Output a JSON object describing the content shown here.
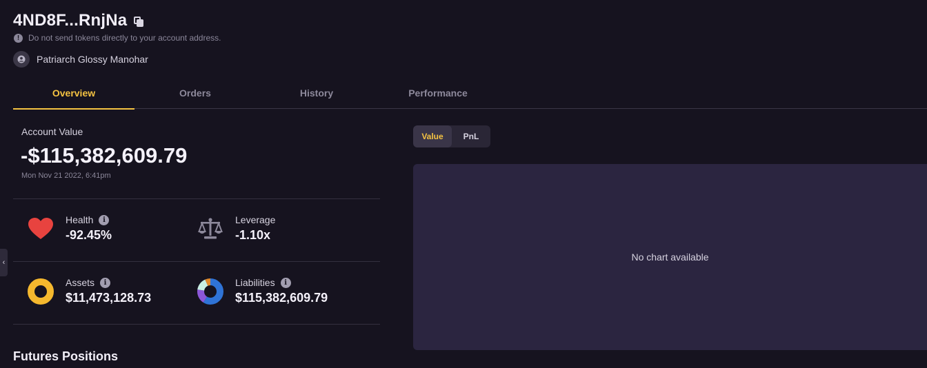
{
  "account": {
    "address_short": "4ND8F...RnjNa",
    "warning": "Do not send tokens directly to your account address.",
    "owner_name": "Patriarch Glossy Manohar"
  },
  "tabs": [
    {
      "label": "Overview",
      "active": true
    },
    {
      "label": "Orders",
      "active": false
    },
    {
      "label": "History",
      "active": false
    },
    {
      "label": "Performance",
      "active": false
    }
  ],
  "summary": {
    "account_value_label": "Account Value",
    "account_value": "-$115,382,609.79",
    "timestamp": "Mon Nov 21 2022, 6:41pm"
  },
  "stats": {
    "health": {
      "label": "Health",
      "value": "-92.45%",
      "icon": "heart-icon"
    },
    "leverage": {
      "label": "Leverage",
      "value": "-1.10x",
      "icon": "scales-icon"
    },
    "assets": {
      "label": "Assets",
      "value": "$11,473,128.73",
      "icon": "assets-donut-icon"
    },
    "liabilities": {
      "label": "Liabilities",
      "value": "$115,382,609.79",
      "icon": "liabilities-donut-icon"
    }
  },
  "chart_toggle": {
    "options": [
      "Value",
      "PnL"
    ],
    "selected": "Value"
  },
  "chart": {
    "empty_message": "No chart available"
  },
  "sections": {
    "futures_title": "Futures Positions"
  },
  "colors": {
    "accent": "#f5c342",
    "health_red": "#e8433f",
    "assets_yellow": "#f5b82e",
    "liab_blue": "#2f73d6",
    "liab_purple": "#8c57d9",
    "liab_mint": "#c9efe3",
    "liab_orange": "#e08a2e"
  }
}
